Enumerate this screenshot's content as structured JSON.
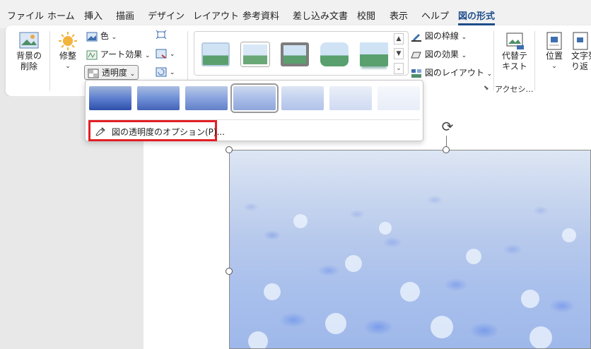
{
  "tabs": [
    "ファイル",
    "ホーム",
    "挿入",
    "描画",
    "デザイン",
    "レイアウト",
    "参考資料",
    "差し込み文書",
    "校閲",
    "表示",
    "ヘルプ",
    "図の形式"
  ],
  "active_tab": "図の形式",
  "ribbon": {
    "remove_bg": {
      "line1": "背景の",
      "line2": "削除"
    },
    "corrections": "修整",
    "color": "色",
    "artistic_effects": "アート効果",
    "transparency": "透明度",
    "picture_border": "図の枠線",
    "picture_effects": "図の効果",
    "picture_layout": "図のレイアウト",
    "alt_text": {
      "line1": "代替テ",
      "line2": "キスト"
    },
    "accessibility_group": "アクセシ…",
    "position": "位置",
    "wrap_text": {
      "line1": "文字列",
      "line2": "り返"
    }
  },
  "transparency_menu": {
    "option_label": "図の透明度のオプション(P)..."
  },
  "colors": {
    "accent": "#1e4e8c",
    "highlight": "#e21f26"
  }
}
